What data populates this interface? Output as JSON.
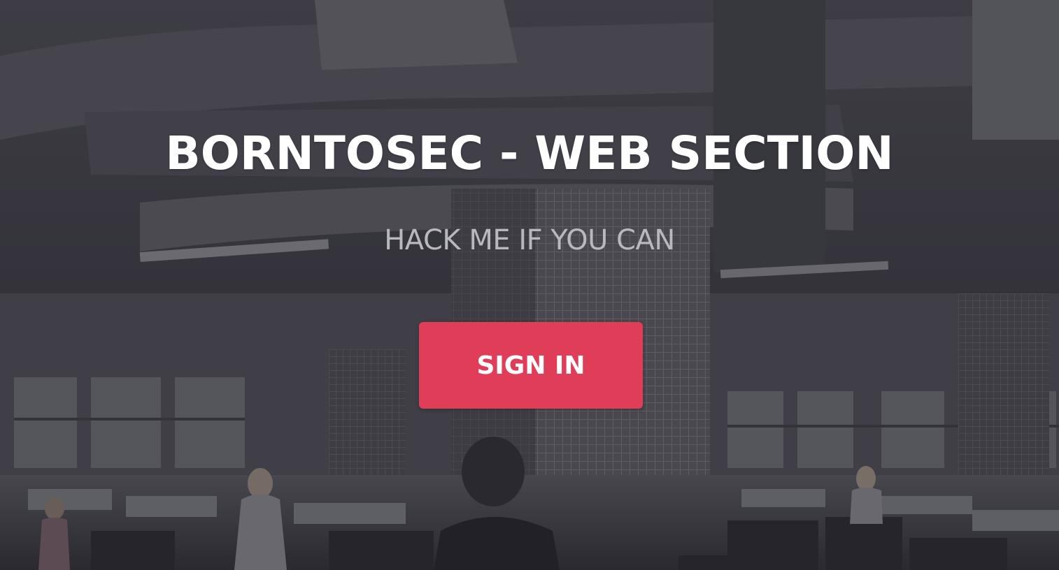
{
  "hero": {
    "title": "BORNTOSEC - WEB SECTION",
    "subtitle": "HACK ME IF YOU CAN",
    "signin_label": "SIGN IN",
    "background_image": "office-interior-photo"
  },
  "colors": {
    "accent": "#e03e58",
    "title": "#ffffff",
    "subtitle": "#b9b8bf",
    "overlay": "#3c3b42"
  }
}
